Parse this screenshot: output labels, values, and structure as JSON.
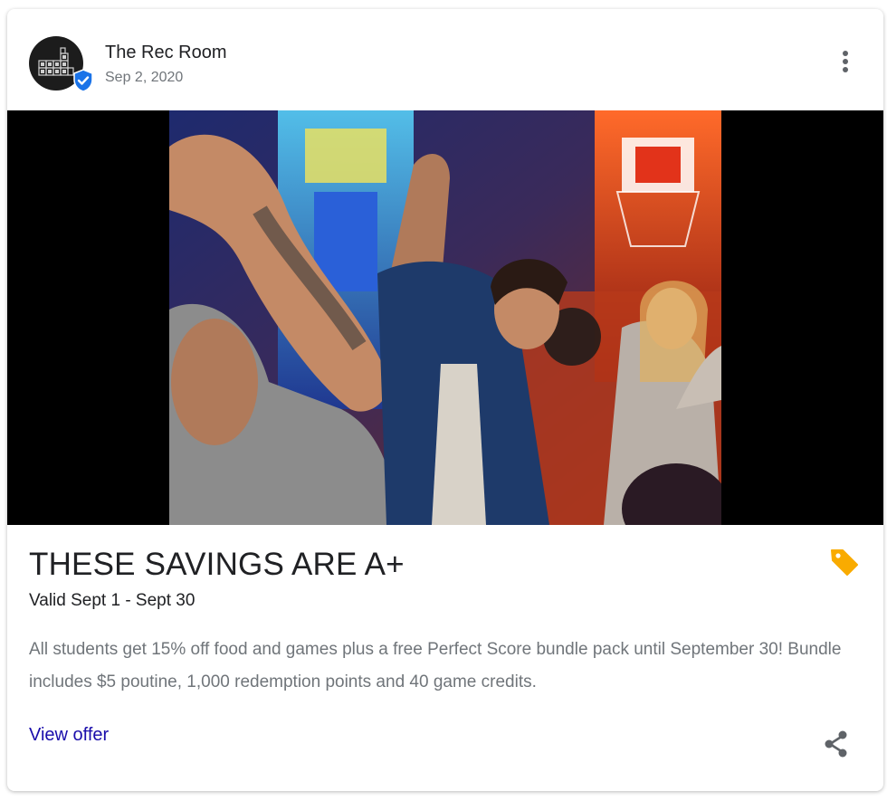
{
  "post": {
    "business_name": "The Rec Room",
    "date": "Sep 2, 2020",
    "logo_text": "REC ROOM",
    "title": "THESE SAVINGS ARE A+",
    "validity": "Valid Sept 1 - Sept 30",
    "description": "All students get 15% off food and games plus a free Perfect Score bundle pack until September 30! Bundle includes $5 poutine, 1,000 redemption points and 40 game credits.",
    "cta_label": "View offer"
  },
  "icons": {
    "verified": "verified-badge-icon",
    "more": "more-vert-icon",
    "offer_tag": "tag-icon",
    "share": "share-icon"
  },
  "colors": {
    "verified_blue": "#1a73e8",
    "tag_yellow": "#f9ab00",
    "link_blue": "#1a0dab",
    "icon_gray": "#5f6368"
  }
}
